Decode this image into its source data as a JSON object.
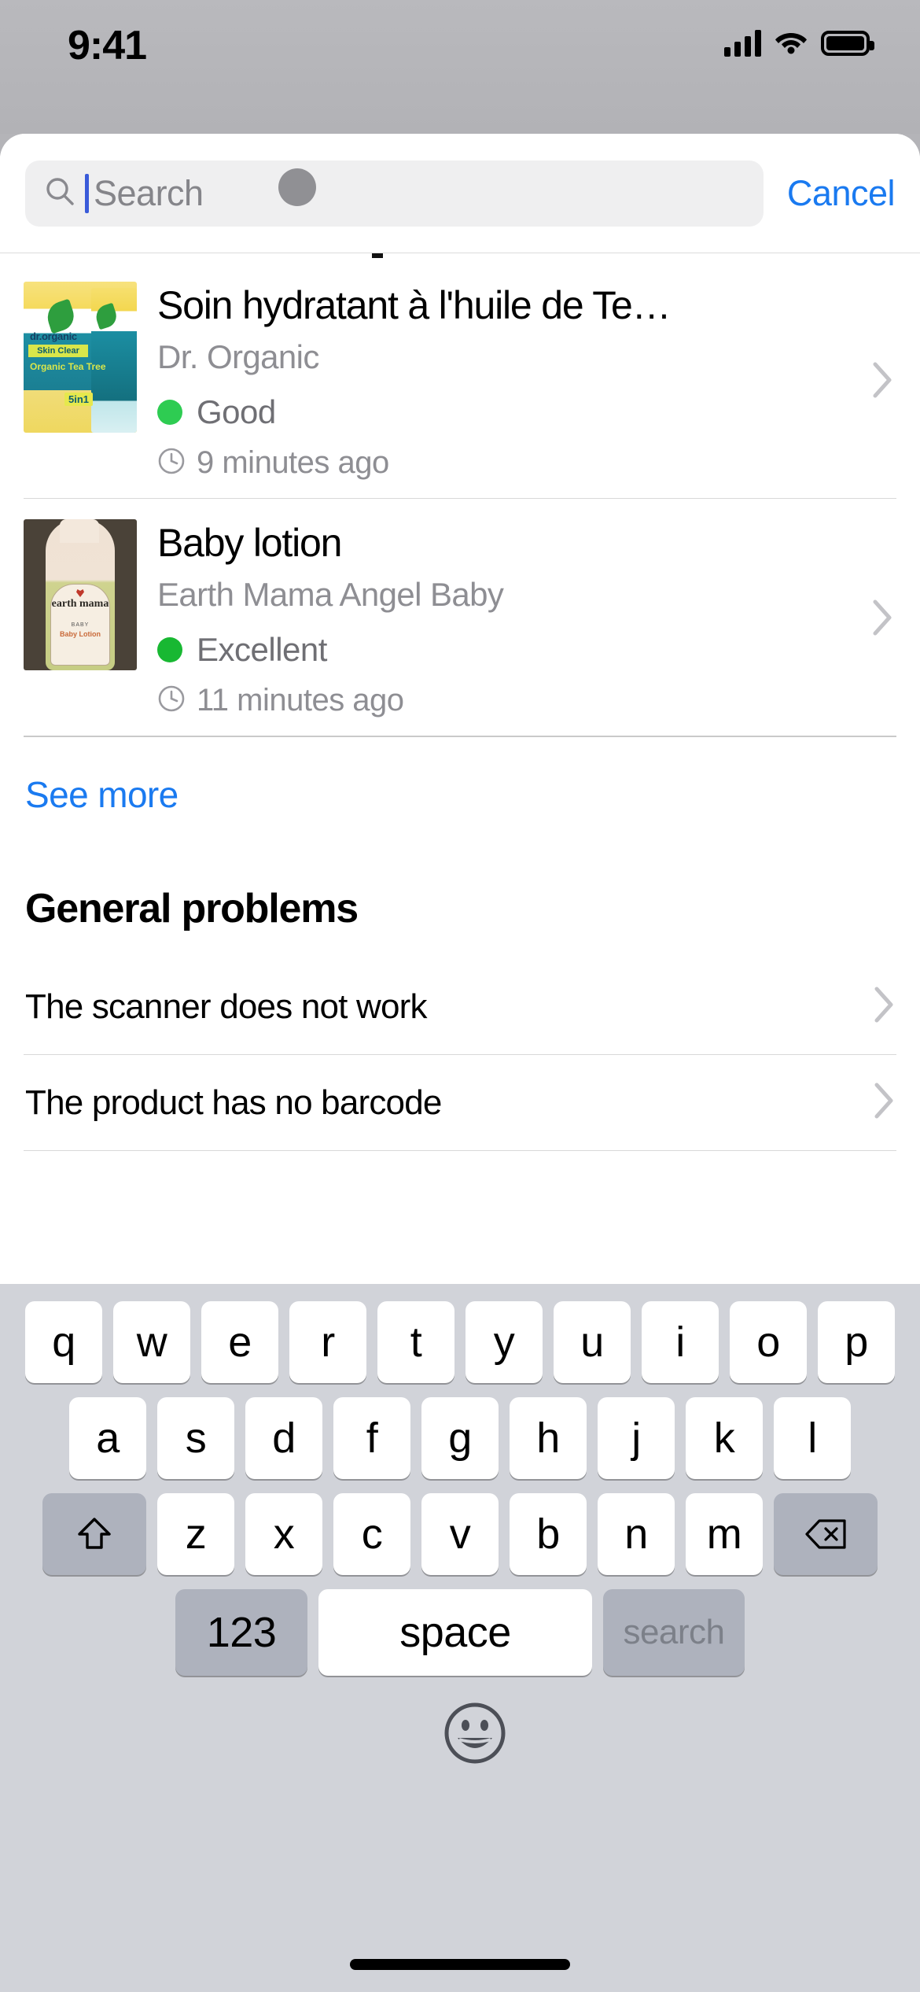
{
  "status_bar": {
    "time": "9:41",
    "icons": [
      "cellular-signal-icon",
      "wifi-icon",
      "battery-icon"
    ]
  },
  "search": {
    "placeholder": "Search",
    "value": "",
    "icon": "search-icon",
    "cancel_label": "Cancel"
  },
  "results": {
    "items": [
      {
        "name": "Soin hydratant à l'huile de Te…",
        "brand": "Dr. Organic",
        "status": "Good",
        "status_color": "#2ECC52",
        "time": "9 minutes ago",
        "thumb_brand": "dr.organic",
        "thumb_line1": "Skin Clear",
        "thumb_line2": "Organic Tea Tree",
        "thumb_badge": "5in1"
      },
      {
        "name": "Baby lotion",
        "brand": "Earth Mama Angel Baby",
        "status": "Excellent",
        "status_color": "#18B832",
        "time": "11 minutes ago",
        "thumb_brand": "earth mama",
        "thumb_line1": "BABY",
        "thumb_line2": "Baby Lotion"
      }
    ],
    "see_more_label": "See more"
  },
  "general_problems": {
    "title": "General problems",
    "items": [
      {
        "label": "The scanner does not work"
      },
      {
        "label": "The product has no barcode"
      }
    ]
  },
  "keyboard": {
    "row1": [
      "q",
      "w",
      "e",
      "r",
      "t",
      "y",
      "u",
      "i",
      "o",
      "p"
    ],
    "row2": [
      "a",
      "s",
      "d",
      "f",
      "g",
      "h",
      "j",
      "k",
      "l"
    ],
    "row3": [
      "z",
      "x",
      "c",
      "v",
      "b",
      "n",
      "m"
    ],
    "shift_label": "shift-icon",
    "backspace_label": "backspace-icon",
    "numbers_label": "123",
    "space_label": "space",
    "search_label": "search",
    "emoji_label": "emoji-icon"
  },
  "colors": {
    "accent_blue": "#1a7af0",
    "status_green": "#2ECC52",
    "keyboard_bg": "#d1d3d9",
    "key_fn": "#aeb2bd"
  }
}
